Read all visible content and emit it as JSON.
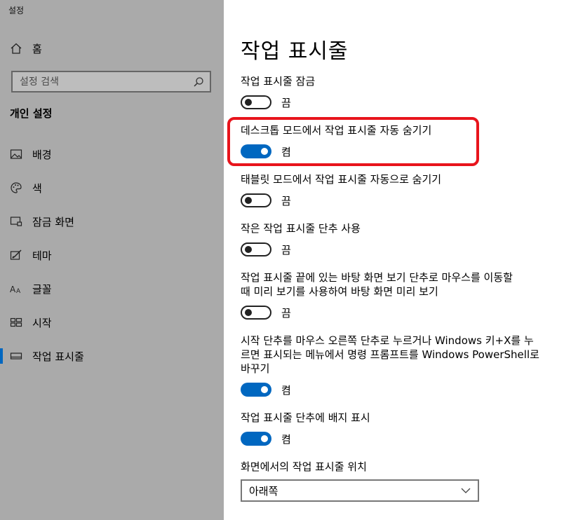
{
  "window": {
    "title": "설정"
  },
  "sidebar": {
    "home_label": "홈",
    "search_placeholder": "설정 검색",
    "section_header": "개인 설정",
    "items": [
      {
        "label": "배경",
        "icon": "image-icon"
      },
      {
        "label": "색",
        "icon": "palette-icon"
      },
      {
        "label": "잠금 화면",
        "icon": "lock-screen-icon"
      },
      {
        "label": "테마",
        "icon": "theme-icon"
      },
      {
        "label": "글꼴",
        "icon": "font-icon"
      },
      {
        "label": "시작",
        "icon": "start-icon"
      },
      {
        "label": "작업 표시줄",
        "icon": "taskbar-icon",
        "active": true
      }
    ]
  },
  "main": {
    "title": "작업 표시줄",
    "settings": [
      {
        "label": "작업 표시줄 잠금",
        "on": false,
        "state": "끔"
      },
      {
        "label": "데스크톱 모드에서 작업 표시줄 자동 숨기기",
        "on": true,
        "state": "켬"
      },
      {
        "label": "태블릿 모드에서 작업 표시줄 자동으로 숨기기",
        "on": false,
        "state": "끔"
      },
      {
        "label": "작은 작업 표시줄 단추 사용",
        "on": false,
        "state": "끔"
      },
      {
        "label_lines": [
          "작업 표시줄 끝에 있는 바탕 화면 보기 단추로 마우스를 이동할",
          "때 미리 보기를 사용하여 바탕 화면 미리 보기"
        ],
        "on": false,
        "state": "끔"
      },
      {
        "label_lines": [
          "시작 단추를 마우스 오른쪽 단추로 누르거나 Windows 키+X를 누",
          "르면 표시되는 메뉴에서 명령 프롬프트를 Windows PowerShell로",
          "바꾸기"
        ],
        "on": true,
        "state": "켬"
      },
      {
        "label": "작업 표시줄 단추에 배지 표시",
        "on": true,
        "state": "켬"
      }
    ],
    "position": {
      "label": "화면에서의 작업 표시줄 위치",
      "value": "아래쪽"
    }
  },
  "colors": {
    "accent": "#0067c0",
    "highlight": "#e8141c",
    "sidebar_bg": "#aaaaaa"
  }
}
